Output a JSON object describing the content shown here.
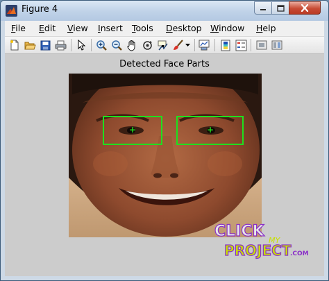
{
  "window": {
    "title": "Figure 4",
    "controls": {
      "minimize_icon": "minimize-icon",
      "maximize_icon": "maximize-icon",
      "close_icon": "close-icon"
    }
  },
  "menu": [
    {
      "label": "File",
      "underline": "F",
      "rest": "ile"
    },
    {
      "label": "Edit",
      "underline": "E",
      "rest": "dit"
    },
    {
      "label": "View",
      "underline": "V",
      "rest": "iew"
    },
    {
      "label": "Insert",
      "underline": "I",
      "rest": "nsert"
    },
    {
      "label": "Tools",
      "underline": "T",
      "rest": "ools"
    },
    {
      "label": "Desktop",
      "underline": "D",
      "rest": "esktop"
    },
    {
      "label": "Window",
      "underline": "W",
      "rest": "indow"
    },
    {
      "label": "Help",
      "underline": "H",
      "rest": "elp"
    }
  ],
  "toolbar": {
    "icons": [
      "new-figure-icon",
      "open-file-icon",
      "save-icon",
      "print-icon",
      "pointer-icon",
      "zoom-in-icon",
      "zoom-out-icon",
      "pan-hand-icon",
      "rotate-3d-icon",
      "data-cursor-icon",
      "brush-icon",
      "dropdown-arrow-icon",
      "link-plot-icon",
      "colorbar-icon",
      "legend-icon",
      "hide-plot-tools-icon",
      "show-plot-tools-icon"
    ]
  },
  "figure": {
    "axes_title": "Detected Face Parts",
    "box_color": "#1ee01e",
    "detections": [
      "left-eye",
      "right-eye"
    ]
  },
  "watermark": {
    "line1": "CLICK",
    "line2": "MY",
    "line3": "PROJECT",
    "suffix": ".COM",
    "color_main": "#e8e8e8",
    "color_accent": "#c7e000",
    "color_purple": "#8a2fc8"
  }
}
